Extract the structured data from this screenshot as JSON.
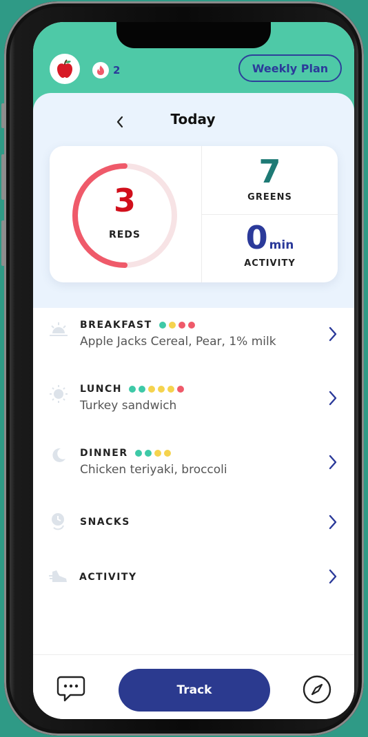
{
  "header": {
    "streak_count": "2",
    "weekly_plan_label": "Weekly Plan"
  },
  "day": {
    "title": "Today"
  },
  "summary": {
    "reds_value": "3",
    "reds_label": "REDS",
    "reds_progress": 0.5,
    "greens_value": "7",
    "greens_label": "GREENS",
    "activity_value": "0",
    "activity_unit": "min",
    "activity_label": "ACTIVITY"
  },
  "meals": [
    {
      "name": "BREAKFAST",
      "desc": "Apple Jacks Cereal, Pear, 1% milk",
      "icon": "sunrise-icon",
      "dots": [
        "green",
        "yellow",
        "red",
        "red"
      ]
    },
    {
      "name": "LUNCH",
      "desc": "Turkey sandwich",
      "icon": "sun-icon",
      "dots": [
        "green",
        "green",
        "yellow",
        "yellow",
        "yellow",
        "red"
      ]
    },
    {
      "name": "DINNER",
      "desc": "Chicken teriyaki, broccoli",
      "icon": "moon-icon",
      "dots": [
        "green",
        "green",
        "yellow",
        "yellow"
      ]
    },
    {
      "name": "SNACKS",
      "desc": "",
      "icon": "clock-icon",
      "dots": []
    },
    {
      "name": "ACTIVITY",
      "desc": "",
      "icon": "sneaker-icon",
      "dots": []
    }
  ],
  "bottom": {
    "track_label": "Track"
  },
  "colors": {
    "teal": "#4ec9a7",
    "navy": "#2b3a8f",
    "red": "#ef5a6a",
    "green": "#3ec9a7",
    "yellow": "#f5d34e"
  }
}
